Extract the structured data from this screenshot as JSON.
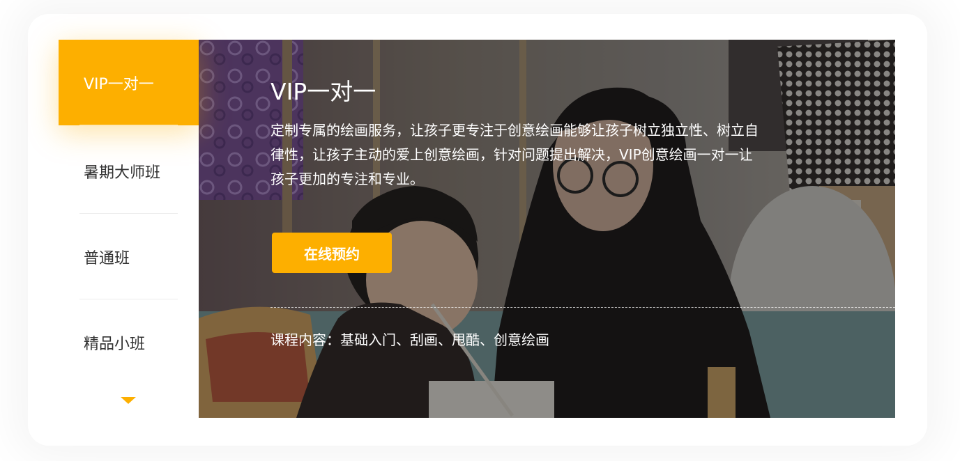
{
  "sidebar": {
    "items": [
      {
        "label": "VIP一对一",
        "active": true
      },
      {
        "label": "暑期大师班",
        "active": false
      },
      {
        "label": "普通班",
        "active": false
      },
      {
        "label": "精品小班",
        "active": false
      }
    ],
    "more_icon": "triangle-down-icon"
  },
  "main": {
    "title": "VIP一对一",
    "description": "定制专属的绘画服务，让孩子更专注于创意绘画能够让孩子树立独立性、树立自律性，让孩子主动的爱上创意绘画，针对问题提出解决，VIP创意绘画一对一让孩子更加的专注和专业。",
    "cta_label": "在线预约",
    "course_content": "课程内容：基础入门、刮画、甩酷、创意绘画"
  },
  "colors": {
    "accent": "#fdaf00",
    "text_dark": "#333333",
    "text_light": "#ffffff"
  }
}
